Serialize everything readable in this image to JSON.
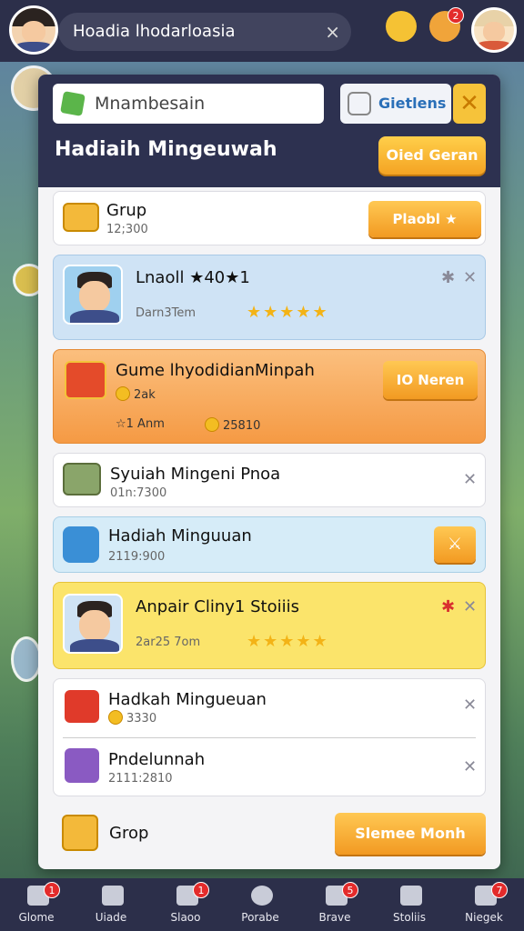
{
  "top_bar": {
    "search_text": "Hoadia lhodarloasia",
    "close": "×",
    "badge_count": "2"
  },
  "panel": {
    "search_label": "Mnambesain",
    "side_button": "Gietlens",
    "close_mark": "✕",
    "title": "Hadiaih Mingeuwah",
    "header_button": "Oied Geran"
  },
  "rows": [
    {
      "title": "Grup",
      "sub": "12;300",
      "button": "Plaobl ★"
    },
    {
      "title": "Lnaoll ★40★1",
      "sub": "Darn3Tem",
      "stars": "★★★★★"
    },
    {
      "title": "Gume lhyodidianMinpah",
      "sub": "2ak",
      "meta_a": "☆1 Anm",
      "meta_b": "25810",
      "button": "IO Neren"
    },
    {
      "title": "Syuiah Mingeni Pnoa",
      "sub": "01n:7300"
    },
    {
      "title": "Hadiah Minguuan",
      "sub": "2119:900"
    },
    {
      "title": "Anpair Cliny1 Stoiiis",
      "sub": "2ar25 7om",
      "stars": "★★★★★"
    },
    {
      "title": "Hadkah Mingueuan",
      "sub": "3330"
    },
    {
      "title": "Pndelunnah",
      "sub": "2111:2810"
    },
    {
      "title": "Grop",
      "button": "Slemee Monh"
    }
  ],
  "bottom_nav": [
    {
      "label": "Glome",
      "badge": "1"
    },
    {
      "label": "Uiade",
      "badge": ""
    },
    {
      "label": "Slaoo",
      "badge": "1"
    },
    {
      "label": "Porabe",
      "badge": ""
    },
    {
      "label": "Brave",
      "badge": "5"
    },
    {
      "label": "Stoliis",
      "badge": ""
    },
    {
      "label": "Niegek",
      "badge": "7"
    }
  ],
  "colors": {
    "accent_orange": "#f4a323",
    "header_navy": "#2d3150",
    "highlight_blue": "#cfe3f5",
    "highlight_yellow": "#fbe46b"
  }
}
